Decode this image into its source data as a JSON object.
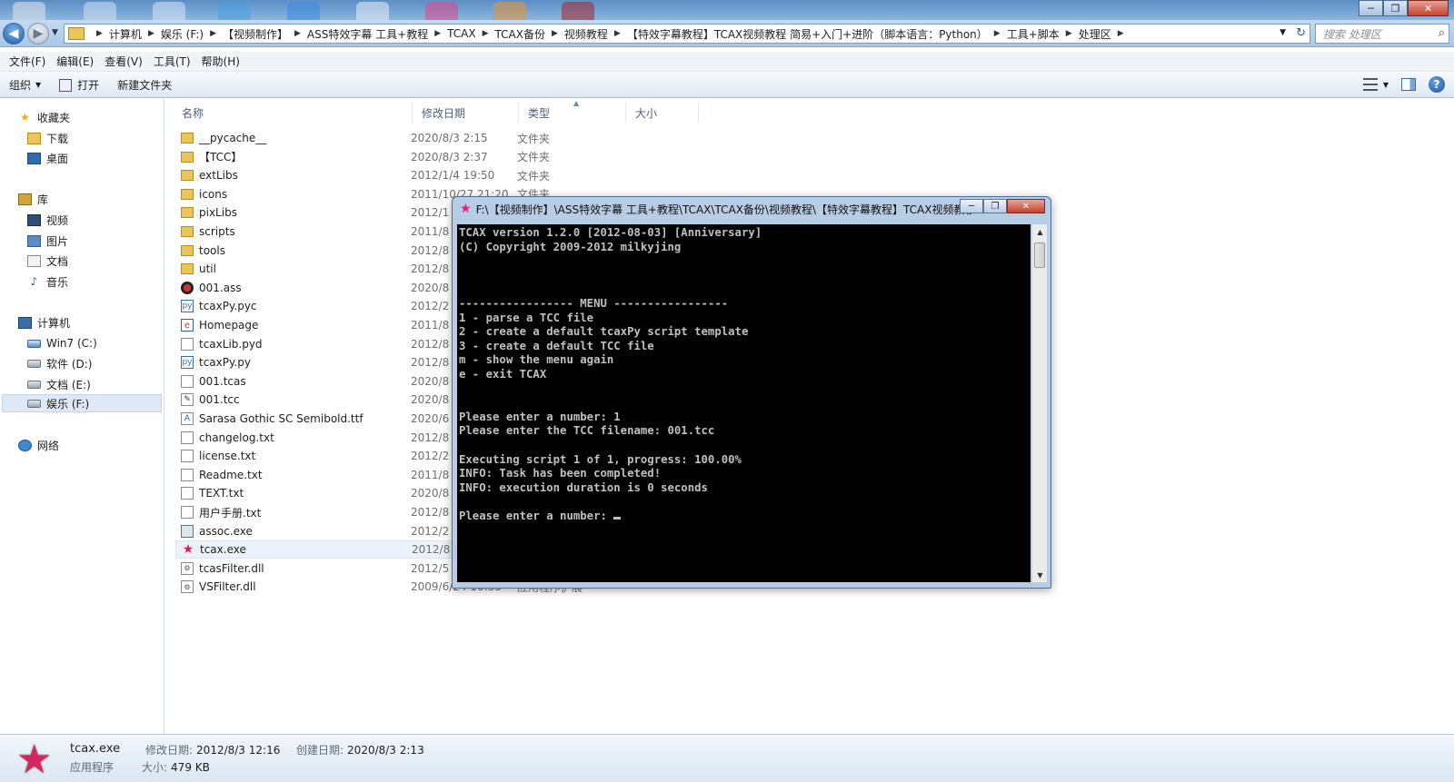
{
  "window": {
    "minimize": "─",
    "maximize": "❐",
    "close": "✕"
  },
  "address": {
    "crumbs": [
      "计算机",
      "娱乐 (F:)",
      "【视频制作】",
      "ASS特效字幕 工具+教程",
      "TCAX",
      "TCAX备份",
      "视频教程",
      "【特效字幕教程】TCAX视频教程 简易+入门+进阶（脚本语言：Python）",
      "工具+脚本",
      "处理区"
    ],
    "search_placeholder": "搜索 处理区"
  },
  "menu": [
    "文件(F)",
    "编辑(E)",
    "查看(V)",
    "工具(T)",
    "帮助(H)"
  ],
  "toolbar": {
    "organize": "组织",
    "open": "打开",
    "new_folder": "新建文件夹"
  },
  "nav": {
    "favorites": "收藏夹",
    "downloads": "下载",
    "desktop": "桌面",
    "library": "库",
    "videos": "视频",
    "pictures": "图片",
    "documents": "文档",
    "music": "音乐",
    "computer": "计算机",
    "drive_c": "Win7 (C:)",
    "drive_d": "软件 (D:)",
    "drive_e": "文档 (E:)",
    "drive_f": "娱乐 (F:)",
    "network": "网络"
  },
  "columns": {
    "name": "名称",
    "date": "修改日期",
    "type": "类型",
    "size": "大小"
  },
  "files": [
    {
      "name": "__pycache__",
      "date": "2020/8/3 2:15",
      "type": "文件夹",
      "icon": "folder-icon"
    },
    {
      "name": "【TCC】",
      "date": "2020/8/3 2:37",
      "type": "文件夹",
      "icon": "folder-icon"
    },
    {
      "name": "extLibs",
      "date": "2012/1/4 19:50",
      "type": "文件夹",
      "icon": "folder-icon"
    },
    {
      "name": "icons",
      "date": "2011/10/27 21:20",
      "type": "文件夹",
      "icon": "folder-icon"
    },
    {
      "name": "pixLibs",
      "date": "2012/1",
      "type": "",
      "icon": "folder-icon"
    },
    {
      "name": "scripts",
      "date": "2011/8",
      "type": "",
      "icon": "folder-icon"
    },
    {
      "name": "tools",
      "date": "2012/8",
      "type": "",
      "icon": "folder-icon"
    },
    {
      "name": "util",
      "date": "2012/8",
      "type": "",
      "icon": "folder-icon"
    },
    {
      "name": "001.ass",
      "date": "2020/8",
      "type": "",
      "icon": "ass-file-icon"
    },
    {
      "name": "tcaxPy.pyc",
      "date": "2012/2",
      "type": "",
      "icon": "python-compiled-icon"
    },
    {
      "name": "Homepage",
      "date": "2011/8",
      "type": "",
      "icon": "internet-shortcut-icon"
    },
    {
      "name": "tcaxLib.pyd",
      "date": "2012/8",
      "type": "",
      "icon": "file-icon"
    },
    {
      "name": "tcaxPy.py",
      "date": "2012/8",
      "type": "",
      "icon": "python-file-icon"
    },
    {
      "name": "001.tcas",
      "date": "2020/8",
      "type": "",
      "icon": "file-icon"
    },
    {
      "name": "001.tcc",
      "date": "2020/8",
      "type": "",
      "icon": "tcc-file-icon"
    },
    {
      "name": "Sarasa Gothic SC Semibold.ttf",
      "date": "2020/6",
      "type": "",
      "icon": "font-file-icon"
    },
    {
      "name": "changelog.txt",
      "date": "2012/8",
      "type": "",
      "icon": "text-file-icon"
    },
    {
      "name": "license.txt",
      "date": "2012/2",
      "type": "",
      "icon": "text-file-icon"
    },
    {
      "name": "Readme.txt",
      "date": "2011/8",
      "type": "",
      "icon": "text-file-icon"
    },
    {
      "name": "TEXT.txt",
      "date": "2020/8",
      "type": "",
      "icon": "text-file-icon"
    },
    {
      "name": "用户手册.txt",
      "date": "2012/8",
      "type": "",
      "icon": "text-file-icon"
    },
    {
      "name": "assoc.exe",
      "date": "2012/2",
      "type": "",
      "icon": "exe-icon"
    },
    {
      "name": "tcax.exe",
      "date": "2012/8",
      "type": "",
      "icon": "tcax-star-icon"
    },
    {
      "name": "tcasFilter.dll",
      "date": "2012/5",
      "type": "",
      "icon": "dll-icon"
    },
    {
      "name": "VSFilter.dll",
      "date": "2009/6/24 10:35",
      "type": "应用程序扩展",
      "icon": "dll-icon"
    }
  ],
  "console": {
    "title": "F:\\【视频制作】\\ASS特效字幕 工具+教程\\TCAX\\TCAX备份\\视频教程\\【特效字幕教程】TCAX视频教程 简易+入门+进阶（脚本语言：Python）\\工具+脚本\\处理区\\tcax.exe",
    "lines": [
      "TCAX version 1.2.0 [2012-08-03] [Anniversary]",
      "(C) Copyright 2009-2012 milkyjing",
      "",
      "",
      "",
      "----------------- MENU -----------------",
      "1 - parse a TCC file",
      "2 - create a default tcaxPy script template",
      "3 - create a default TCC file",
      "m - show the menu again",
      "e - exit TCAX",
      "",
      "",
      "Please enter a number: 1",
      "Please enter the TCC filename: 001.tcc",
      "",
      "Executing script 1 of 1, progress: 100.00%",
      "INFO: Task has been completed!",
      "INFO: execution duration is 0 seconds",
      "",
      "Please enter a number: "
    ]
  },
  "details": {
    "filename": "tcax.exe",
    "modified_label": "修改日期:",
    "modified": "2012/8/3 12:16",
    "created_label": "创建日期:",
    "created": "2020/8/3 2:13",
    "type": "应用程序",
    "size_label": "大小:",
    "size": "479 KB"
  }
}
